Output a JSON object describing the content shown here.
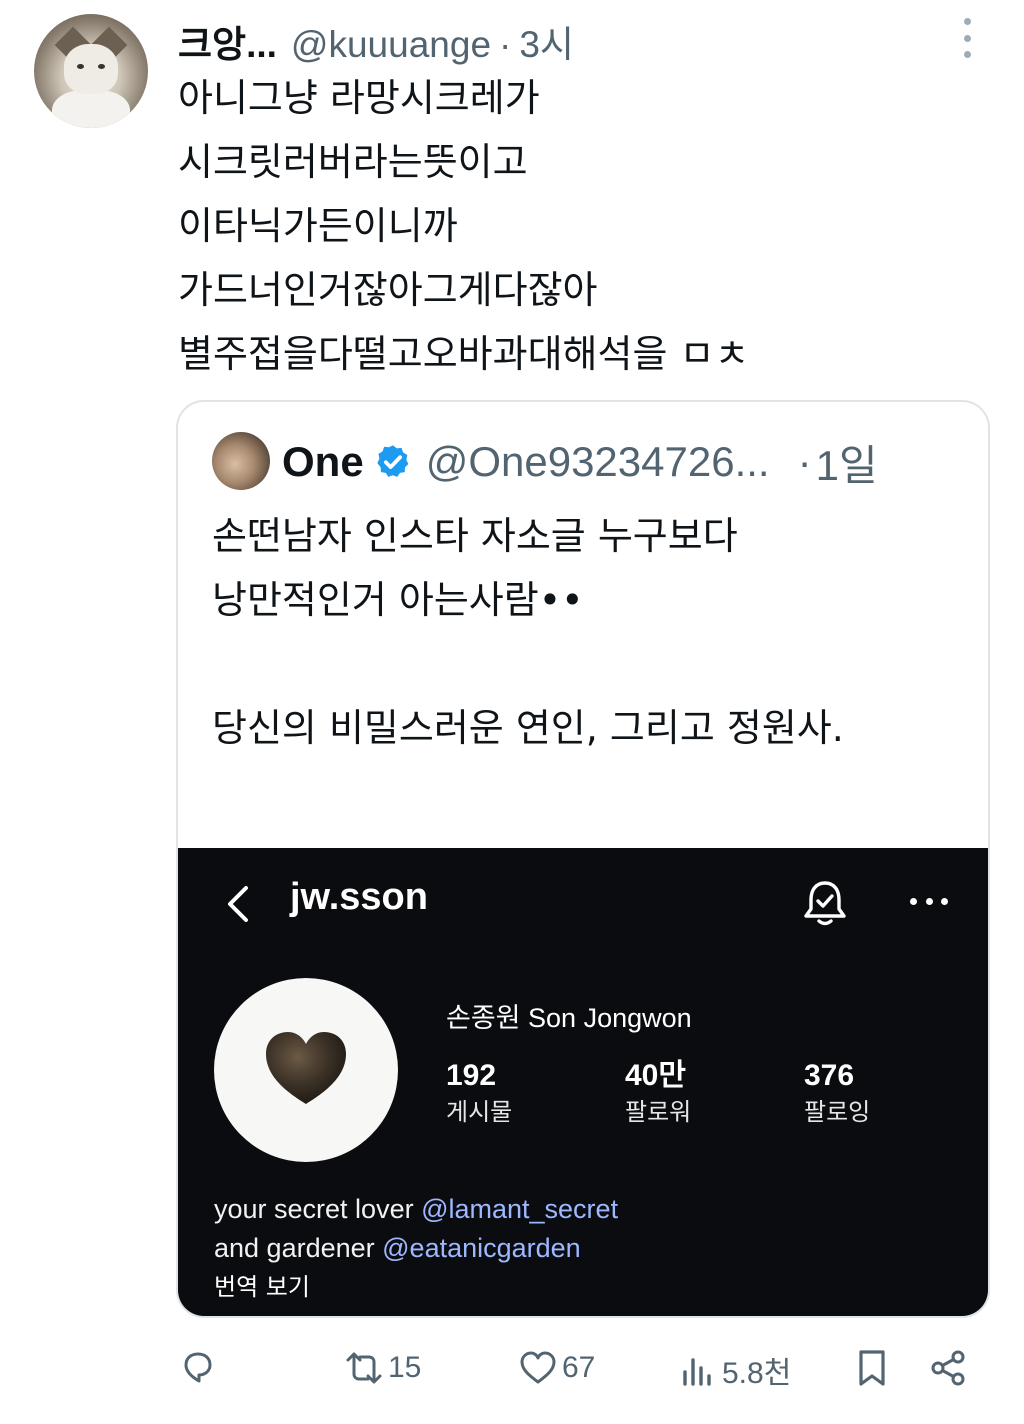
{
  "post": {
    "author_name": "크앙...",
    "author_handle": "@kuuuange",
    "separator": "·",
    "time": "3시",
    "text": "아니그냥 라망시크레가\n시크릿러버라는뜻이고\n이타닉가든이니까\n가드너인거잖아그게다잖아\n별주접을다떨고오바과대해석을 ㅁㅊ"
  },
  "quote": {
    "name": "One",
    "handle": "@One93234726...",
    "separator": "·",
    "time": "1일",
    "text": "손떤남자 인스타 자소글 누구보다\n낭만적인거 아는사람••\n\n당신의 비밀스러운 연인, 그리고 정원사.",
    "ellipsis": "..."
  },
  "instagram": {
    "username": "jw.sson",
    "full_name": "손종원 Son Jongwon",
    "stats": [
      {
        "value": "192",
        "label": "게시물"
      },
      {
        "value": "40만",
        "label": "팔로워"
      },
      {
        "value": "376",
        "label": "팔로잉"
      }
    ],
    "bio_line1_prefix": "your secret lover ",
    "bio_line1_mention": "@lamant_secret",
    "bio_line2_prefix": "and gardener ",
    "bio_line2_mention": "@eatanicgarden",
    "translate": "번역 보기"
  },
  "actions": {
    "retweets": "15",
    "likes": "67",
    "views": "5.8천"
  },
  "icons": [
    "more-vertical-icon",
    "verified-badge-icon",
    "back-chevron-icon",
    "notification-bell-icon",
    "more-horizontal-icon",
    "reply-icon",
    "retweet-icon",
    "like-icon",
    "views-icon",
    "bookmark-icon",
    "share-icon"
  ],
  "colors": {
    "text": "#0f1419",
    "secondary": "#536471",
    "verified": "#1d9bf0",
    "mention": "#9db8ff",
    "insta_bg": "#0b0c10"
  }
}
